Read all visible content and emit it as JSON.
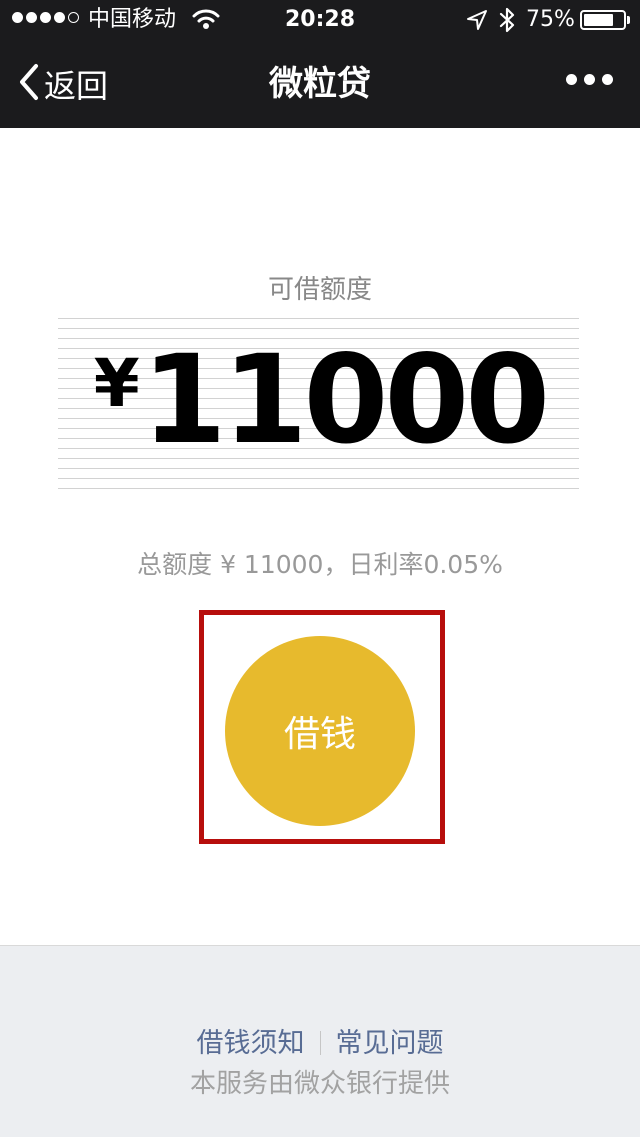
{
  "status_bar": {
    "carrier": "中国移动",
    "time": "20:28",
    "battery_percent": "75%",
    "battery_level": 0.75,
    "signal_bars": 4,
    "icons": [
      "signal-dots-icon",
      "wifi-icon",
      "location-arrow-icon",
      "bluetooth-icon",
      "battery-icon"
    ]
  },
  "nav": {
    "back_label": "返回",
    "title": "微粒贷",
    "more_icon": "more-dots-icon"
  },
  "credit": {
    "label": "可借额度",
    "currency_symbol": "¥",
    "amount": "11000",
    "total_info": "总额度 ¥ 11000，日利率0.05%"
  },
  "action": {
    "borrow_label": "借钱"
  },
  "footer": {
    "link_notice": "借钱须知",
    "link_faq": "常见问题",
    "provider_note": "本服务由微众银行提供"
  },
  "colors": {
    "bar_background": "#1b1b1d",
    "button_gold": "#e7ba2d",
    "highlight_red": "#b70e0c",
    "link_blue": "#586c94",
    "footer_background": "#eceef1"
  }
}
